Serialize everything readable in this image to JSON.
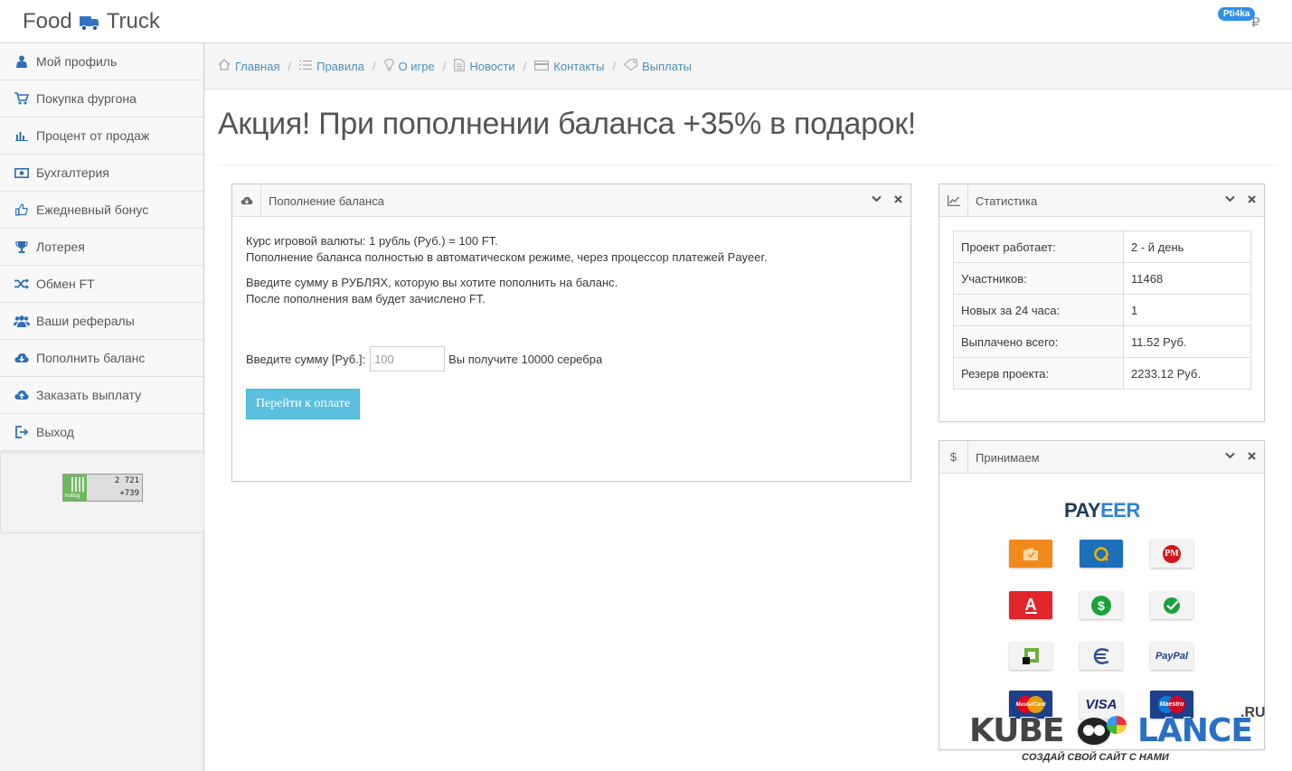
{
  "brand": {
    "part1": "Food",
    "part2": "Truck"
  },
  "user": {
    "name": "Pti4ka",
    "currency_symbol": "₽"
  },
  "sidebar": {
    "items": [
      {
        "label": "Мой профиль",
        "icon": "user-icon"
      },
      {
        "label": "Покупка фургона",
        "icon": "cart-icon"
      },
      {
        "label": "Процент от продаж",
        "icon": "bar-chart-icon"
      },
      {
        "label": "Бухгалтерия",
        "icon": "money-icon"
      },
      {
        "label": "Ежедневный бонус",
        "icon": "thumbs-up-icon"
      },
      {
        "label": "Лотерея",
        "icon": "trophy-icon"
      },
      {
        "label": "Обмен FT",
        "icon": "shuffle-icon"
      },
      {
        "label": "Ваши рефералы",
        "icon": "users-icon"
      },
      {
        "label": "Пополнить баланс",
        "icon": "cloud-download-icon"
      },
      {
        "label": "Заказать выплату",
        "icon": "cloud-upload-icon"
      },
      {
        "label": "Выход",
        "icon": "logout-icon"
      }
    ],
    "counter": {
      "brand": "hotlog",
      "value1": "2 721",
      "value2": "+739"
    }
  },
  "breadcrumbs": [
    {
      "label": "Главная",
      "icon": "home-icon"
    },
    {
      "label": "Правила",
      "icon": "list-icon"
    },
    {
      "label": "О игре",
      "icon": "lightbulb-icon"
    },
    {
      "label": "Новости",
      "icon": "document-icon"
    },
    {
      "label": "Контакты",
      "icon": "card-icon"
    },
    {
      "label": "Выплаты",
      "icon": "tag-icon"
    }
  ],
  "page_title": "Акция! При пополнении баланса +35% в подарок!",
  "balance_widget": {
    "title": "Пополнение баланса",
    "line1": "Курс игровой валюты: 1 рубль (Руб.) = 100 FT.",
    "line2": "Пополнение баланса полностью в автоматическом режиме, через процессор платежей Payeer.",
    "line3": "Введите сумму в РУБЛЯХ, которую вы хотите пополнить на баланс.",
    "line4": "После пополнения вам будет зачислено FT.",
    "amount_label": "Введите сумму [Руб.]:",
    "amount_value": "100",
    "result_text": "Вы получите 10000 серебра",
    "pay_button": "Перейти к оплате"
  },
  "stats_widget": {
    "title": "Статистика",
    "rows": [
      {
        "label": "Проект работает:",
        "value": "2 - й день"
      },
      {
        "label": "Участников:",
        "value": "11468"
      },
      {
        "label": "Новых за 24 часа:",
        "value": "1"
      },
      {
        "label": "Выплачено всего:",
        "value": "11.52 Руб."
      },
      {
        "label": "Резерв проекта:",
        "value": "2233.12 Руб."
      }
    ]
  },
  "payments_widget": {
    "title": "Принимаем",
    "logo_part1": "PAY",
    "logo_part2": "EER",
    "methods": [
      {
        "name": "yandex-money-icon",
        "label": ""
      },
      {
        "name": "qiwi-icon",
        "label": ""
      },
      {
        "name": "perfect-money-icon",
        "label": "PM"
      },
      {
        "name": "alfa-bank-icon",
        "label": "А"
      },
      {
        "name": "money-transfer-icon",
        "label": "$"
      },
      {
        "name": "sberbank-icon",
        "label": ""
      },
      {
        "name": "privat-bank-icon",
        "label": ""
      },
      {
        "name": "euroset-icon",
        "label": ""
      },
      {
        "name": "paypal-icon",
        "label": "PayPal"
      },
      {
        "name": "mastercard-icon",
        "label": "MasterCard"
      },
      {
        "name": "visa-icon",
        "label": "VISA"
      },
      {
        "name": "maestro-icon",
        "label": "Maestro"
      }
    ]
  },
  "watermark": {
    "part1": "KUBE",
    "part2": "LANCE",
    "suffix": ".RU",
    "tagline": "СОЗДАЙ СВОЙ САЙТ С НАМИ"
  },
  "colors": {
    "link": "#4c8fbd",
    "accent": "#2f72c2",
    "button": "#5bc0de"
  }
}
